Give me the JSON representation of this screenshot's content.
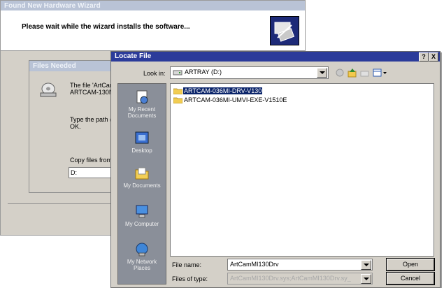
{
  "wizard": {
    "title": "Found New Hardware Wizard",
    "message": "Please wait while the wizard installs the software..."
  },
  "files_needed": {
    "title": "Files Needed",
    "text1_line1": "The file 'ArtCan",
    "text1_line2": "ARTCAM-130M",
    "text2_line1": "Type the path (",
    "text2_line2": "OK.",
    "copy_label": "Copy files from:",
    "copy_value": "D:"
  },
  "locate": {
    "title": "Locate File",
    "help_btn": "?",
    "close_btn": "X",
    "look_in_label": "Look in:",
    "look_in_value": "ARTRAY (D:)",
    "places": [
      {
        "label": "My Recent Documents",
        "icon": "recent-documents-icon"
      },
      {
        "label": "Desktop",
        "icon": "desktop-icon"
      },
      {
        "label": "My Documents",
        "icon": "my-documents-icon"
      },
      {
        "label": "My Computer",
        "icon": "my-computer-icon"
      },
      {
        "label": "My Network Places",
        "icon": "network-places-icon"
      }
    ],
    "files": [
      {
        "name": "ARTCAM-036MI-DRV-V130",
        "selected": true
      },
      {
        "name": "ARTCAM-036MI-UMVI-EXE-V1510E",
        "selected": false
      }
    ],
    "file_name_label": "File name:",
    "file_name_value": "ArtCamMI130Drv",
    "file_type_label": "Files of type:",
    "file_type_value": "ArtCamMI130Drv.sys;ArtCamMI130Drv.sy_",
    "open_btn": "Open",
    "cancel_btn": "Cancel"
  }
}
